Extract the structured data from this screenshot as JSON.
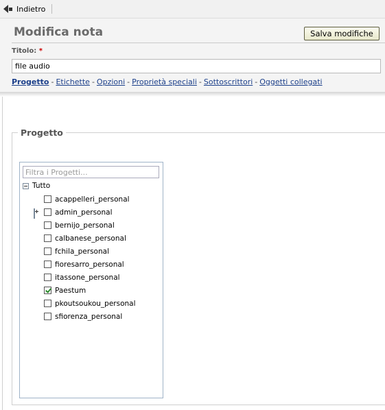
{
  "toolbar": {
    "back_label": "Indietro"
  },
  "header": {
    "title": "Modifica nota",
    "save_label": "Salva modifiche",
    "title_field_label": "Titolo:",
    "required_mark": "*",
    "title_value": "file audio"
  },
  "sections": {
    "links": [
      "Progetto",
      "Etichette",
      "Opzioni",
      "Proprietà speciali",
      "Sottoscrittori",
      "Oggetti collegati"
    ],
    "active": "Progetto"
  },
  "project": {
    "legend": "Progetto",
    "filter_placeholder": "Filtra i Progetti...",
    "root_label": "Tutto",
    "items": [
      {
        "label": "acappelleri_personal",
        "checked": false,
        "expandable": false
      },
      {
        "label": "admin_personal",
        "checked": false,
        "expandable": true
      },
      {
        "label": "bernijo_personal",
        "checked": false,
        "expandable": false
      },
      {
        "label": "calbanese_personal",
        "checked": false,
        "expandable": false
      },
      {
        "label": "fchila_personal",
        "checked": false,
        "expandable": false
      },
      {
        "label": "fioresarro_personal",
        "checked": false,
        "expandable": false
      },
      {
        "label": "itassone_personal",
        "checked": false,
        "expandable": false
      },
      {
        "label": "Paestum",
        "checked": true,
        "expandable": false
      },
      {
        "label": "pkoutsoukou_personal",
        "checked": false,
        "expandable": false
      },
      {
        "label": "sfiorenza_personal",
        "checked": false,
        "expandable": false
      }
    ]
  },
  "colors": {
    "link": "#1b3f8a",
    "required": "#cc0000",
    "check": "#2a8a2a"
  }
}
